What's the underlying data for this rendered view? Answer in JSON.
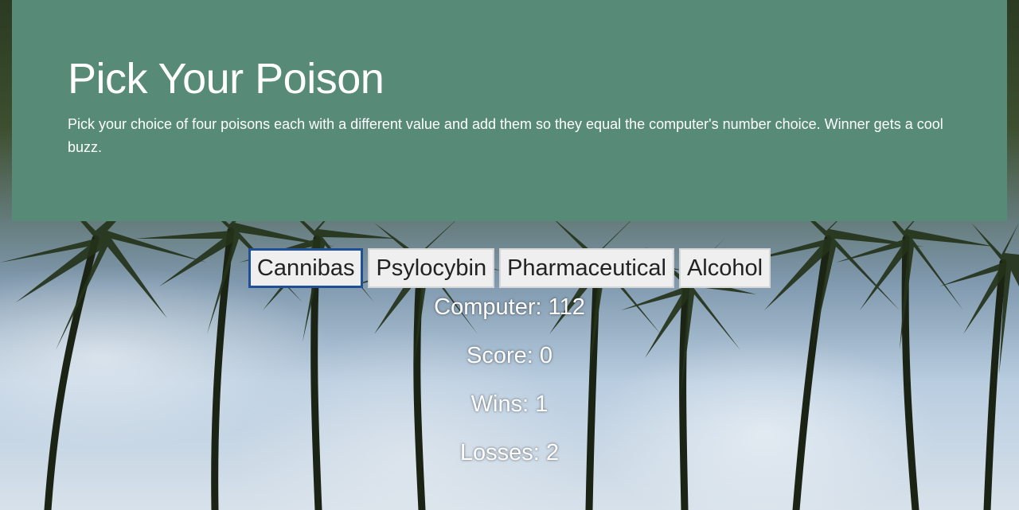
{
  "header": {
    "title": "Pick Your Poison",
    "description": "Pick your choice of four poisons each with a different value and add them so they equal the computer's number choice. Winner gets a cool buzz."
  },
  "buttons": [
    {
      "label": "Cannibas"
    },
    {
      "label": "Psylocybin"
    },
    {
      "label": "Pharmaceutical"
    },
    {
      "label": "Alcohol"
    }
  ],
  "stats": {
    "computer": "Computer: 112",
    "score": "Score: 0",
    "wins": "Wins: 1",
    "losses": "Losses: 2"
  },
  "colors": {
    "jumbotron": "#578b78",
    "focus_ring": "#1f4f96"
  }
}
